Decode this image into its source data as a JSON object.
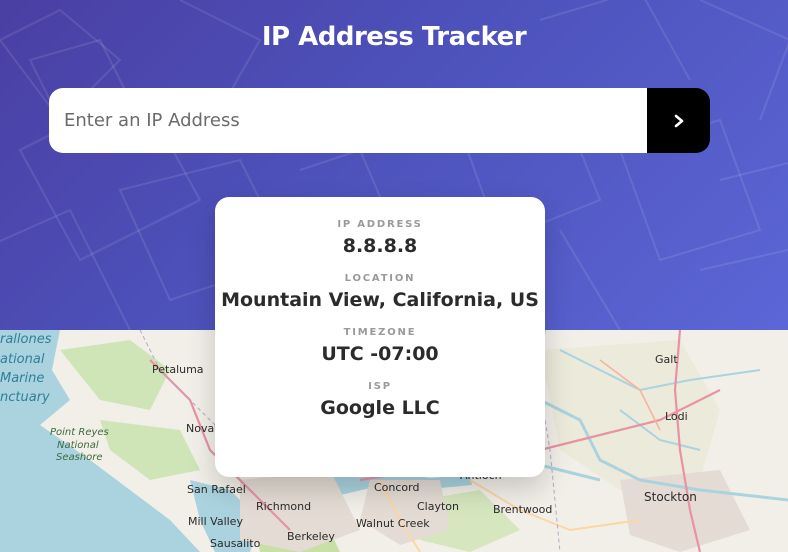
{
  "header": {
    "title": "IP Address Tracker"
  },
  "search": {
    "placeholder": "Enter an IP Address",
    "submit_icon": "chevron-right-icon"
  },
  "info": {
    "ip_label": "IP ADDRESS",
    "ip_value": "8.8.8.8",
    "location_label": "LOCATION",
    "location_value": "Mountain View, California, US",
    "timezone_label": "TIMEZONE",
    "timezone_value": "UTC -07:00",
    "isp_label": "ISP",
    "isp_value": "Google LLC"
  },
  "map": {
    "labels": {
      "farallones": "rallones",
      "national": "ational",
      "marine": "Marine",
      "sanctuary": "nctuary",
      "point_reyes": "Point Reyes",
      "point_reyes_2": "National",
      "point_reyes_3": "Seashore",
      "petaluma": "Petaluma",
      "novato": "Novato",
      "san_rafael": "San Rafael",
      "mill_valley": "Mill Valley",
      "sausalito": "Sausalito",
      "richmond": "Richmond",
      "berkeley": "Berkeley",
      "concord": "Concord",
      "clayton": "Clayton",
      "walnut_creek": "Walnut Creek",
      "antioch": "Antioch",
      "brentwood": "Brentwood",
      "galt": "Galt",
      "lodi": "Lodi",
      "stockton": "Stockton"
    }
  },
  "colors": {
    "header_start": "#4a3fa3",
    "header_end": "#5c66d6",
    "button": "#000000",
    "water": "#aad3df",
    "land": "#f2efe9"
  }
}
